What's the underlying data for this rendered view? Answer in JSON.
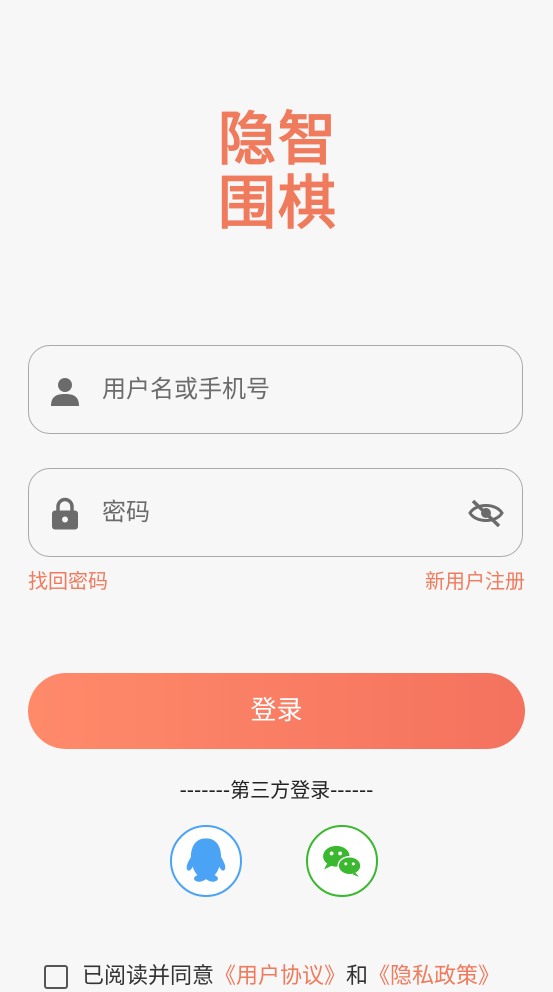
{
  "logo": {
    "chars": [
      "隐",
      "智",
      "围",
      "棋"
    ]
  },
  "username": {
    "placeholder": "用户名或手机号",
    "icon": "person-icon"
  },
  "password": {
    "placeholder": "密码",
    "icon": "lock-icon",
    "toggle_icon": "eye-off-icon"
  },
  "links": {
    "forgot": "找回密码",
    "register": "新用户注册"
  },
  "login_button": "登录",
  "third_party": {
    "title": "-------第三方登录------",
    "qq_icon": "qq-icon",
    "wechat_icon": "wechat-icon"
  },
  "agreement": {
    "prefix": "已阅读并同意",
    "user_agreement": "《用户协议》",
    "and": "和",
    "privacy": "《隐私政策》"
  },
  "colors": {
    "accent": "#f07a5c",
    "qq": "#4aa3f4",
    "wechat": "#3bb82f"
  }
}
